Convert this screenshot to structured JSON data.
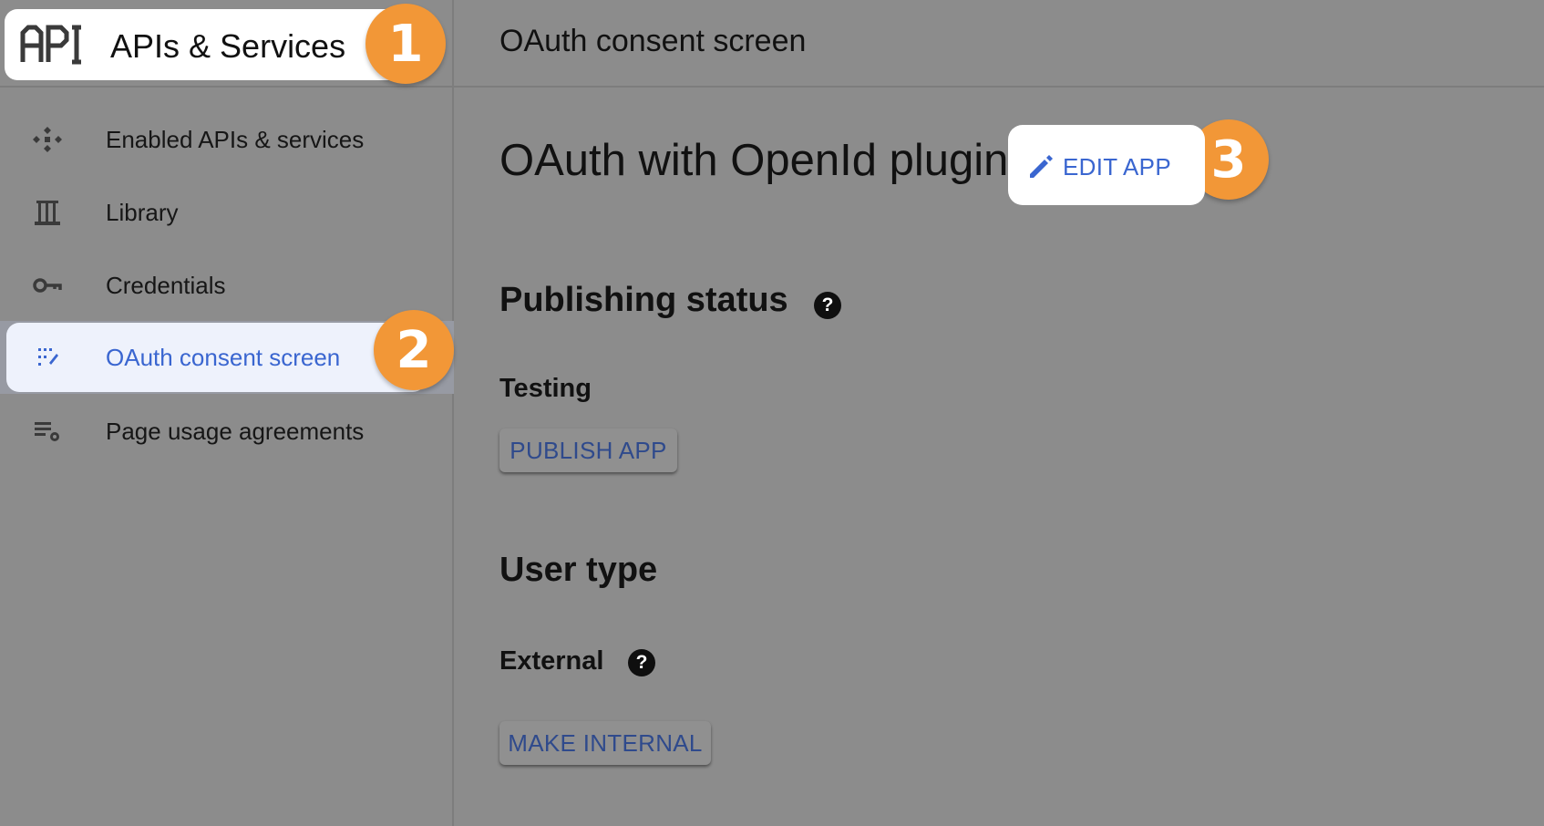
{
  "sidebar": {
    "logo_icon": "api-logo",
    "title": "APIs & Services",
    "items": [
      {
        "label": "Enabled APIs & services",
        "icon": "enabled-apis-icon"
      },
      {
        "label": "Library",
        "icon": "library-icon"
      },
      {
        "label": "Credentials",
        "icon": "key-icon"
      },
      {
        "label": "OAuth consent screen",
        "icon": "consent-screen-icon",
        "active": true
      },
      {
        "label": "Page usage agreements",
        "icon": "page-settings-icon"
      }
    ]
  },
  "header": {
    "title": "OAuth consent screen"
  },
  "app": {
    "name": "OAuth with OpenId plugin",
    "edit_label": "EDIT APP"
  },
  "publishing": {
    "title": "Publishing status",
    "status": "Testing",
    "button": "PUBLISH APP"
  },
  "user_type": {
    "title": "User type",
    "value": "External",
    "button": "MAKE INTERNAL"
  },
  "badges": {
    "one": "1",
    "two": "2",
    "three": "3"
  },
  "colors": {
    "overlay_gray": "#8c8c8c",
    "accent_blue": "#3a66d0",
    "badge_orange": "#f29737",
    "active_pill": "#eef2fc"
  }
}
